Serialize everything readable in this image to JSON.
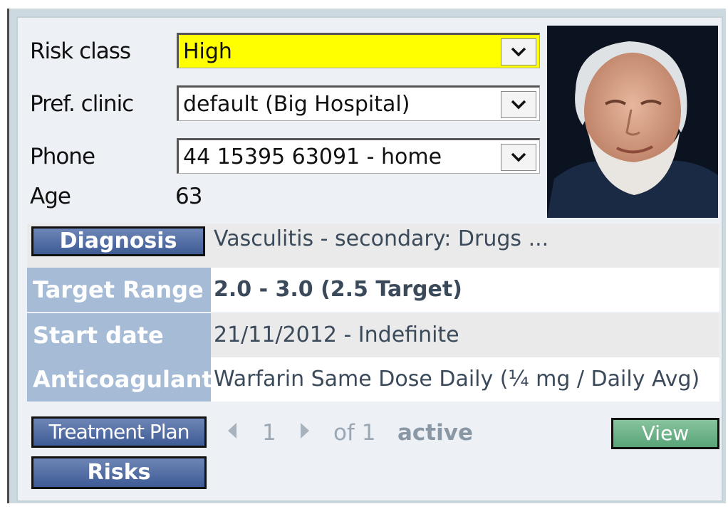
{
  "fields": {
    "risk_class": {
      "label": "Risk class",
      "value": "High"
    },
    "pref_clinic": {
      "label": "Pref. clinic",
      "value": "default (Big Hospital)"
    },
    "phone": {
      "label": "Phone",
      "value": "44 15395 63091 - home"
    },
    "age": {
      "label": "Age",
      "value": "63"
    }
  },
  "rows": {
    "diagnosis": {
      "label": "Diagnosis",
      "value": "Vasculitis - secondary: Drugs  ..."
    },
    "target_range": {
      "label": "Target Range",
      "value": "2.0 - 3.0 (2.5 Target)"
    },
    "start_date": {
      "label": "Start date",
      "value": "21/11/2012 - Indefinite"
    },
    "anticoagulant": {
      "label": "Anticoagulant",
      "value": "Warfarin Same Dose Daily (¼ mg / Daily Avg)"
    }
  },
  "buttons": {
    "treatment_plan": "Treatment Plan",
    "risks": "Risks",
    "view": "View"
  },
  "pager": {
    "page": "1",
    "of_text": "of 1",
    "status": "active"
  },
  "colors": {
    "risk_highlight": "#ffff00",
    "label_bg": "#a6bcd6",
    "view_button": "#6fb58b"
  },
  "icons": [
    "chevron-down-icon",
    "prev-arrow-icon",
    "next-arrow-icon",
    "patient-photo"
  ]
}
